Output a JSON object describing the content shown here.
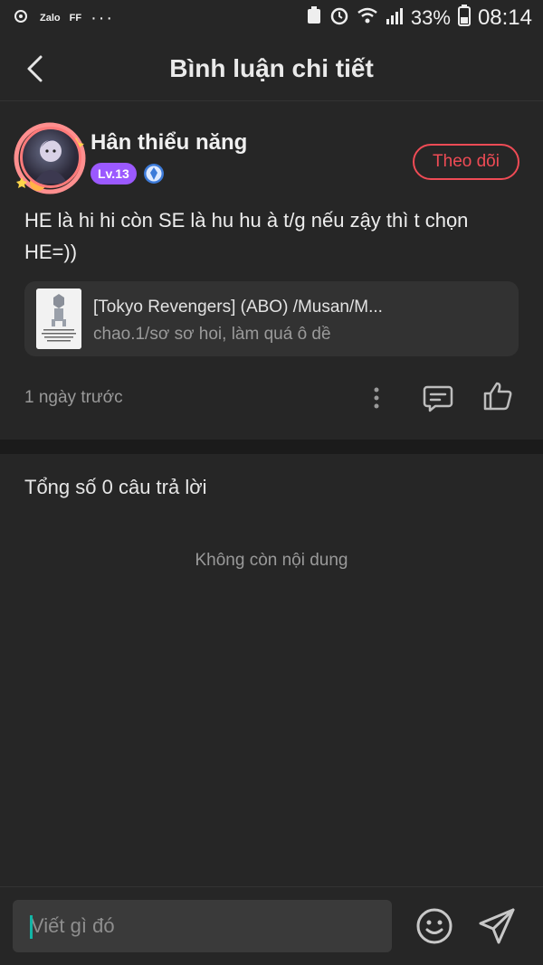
{
  "status_bar": {
    "left_labels": [
      "Zalo",
      "FF"
    ],
    "more": "···",
    "battery": "33%",
    "time": "08:14"
  },
  "header": {
    "title": "Bình luận chi tiết"
  },
  "comment": {
    "username": "Hân thiểu năng",
    "level": "Lv.13",
    "follow_label": "Theo dõi",
    "text": "HE là hi hi còn SE là hu hu à t/g nếu zậy thì t chọn HE=))",
    "book": {
      "title": "[Tokyo Revengers] (ABO) /Musan/M...",
      "subtitle": "chao.1/sơ sơ hoi, làm quá ô dề"
    },
    "time": "1 ngày trước"
  },
  "replies": {
    "count_label": "Tổng số 0 câu trả lời",
    "empty_label": "Không còn nội dung"
  },
  "composer": {
    "placeholder": "Viết gì đó"
  },
  "colors": {
    "background": "#262626",
    "accent_red": "#ef4b55",
    "level_purple": "#9b59ff",
    "caret_teal": "#12b5a5"
  }
}
